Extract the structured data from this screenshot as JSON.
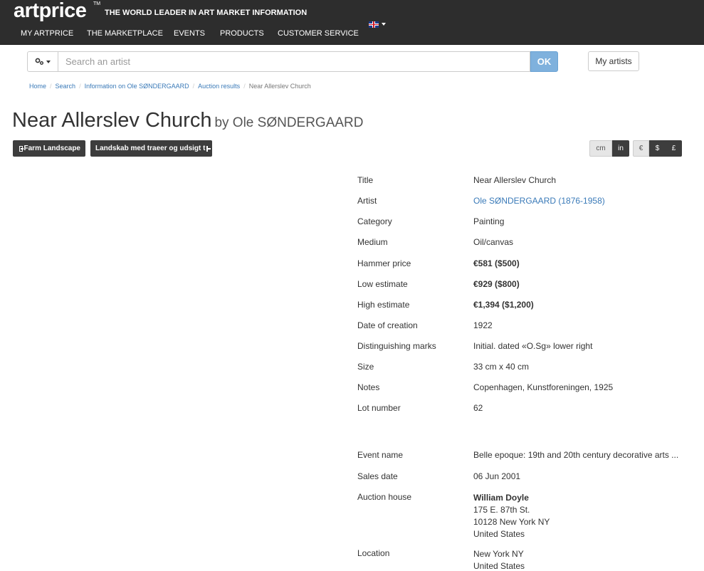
{
  "header": {
    "logo": "artprice",
    "logo_tm": "TM",
    "tagline": "THE WORLD LEADER IN ART MARKET INFORMATION",
    "nav": [
      "MY ARTPRICE",
      "THE MARKETPLACE",
      "EVENTS",
      "PRODUCTS",
      "CUSTOMER SERVICE"
    ],
    "language_icon": "uk-flag-icon"
  },
  "search": {
    "placeholder": "Search an artist",
    "ok_label": "OK",
    "options_icon": "gears-icon",
    "my_artists_label": "My artists"
  },
  "breadcrumb": [
    "Home",
    "Search",
    "Information on Ole SØNDERGAARD",
    "Auction results",
    "Near Allerslev Church"
  ],
  "title": {
    "artwork": "Near Allerslev Church",
    "by": "by Ole SØNDERGAARD"
  },
  "tags": {
    "prev": "Farm Landscape",
    "next": "Landskab med traeer og udsigt t"
  },
  "units": {
    "length": [
      "cm",
      "in"
    ],
    "currency": [
      "€",
      "$",
      "£"
    ]
  },
  "details": [
    {
      "label": "Title",
      "value": "Near Allerslev Church"
    },
    {
      "label": "Artist",
      "value": "Ole SØNDERGAARD (1876-1958)"
    },
    {
      "label": "Category",
      "value": "Painting"
    },
    {
      "label": "Medium",
      "value": "Oil/canvas"
    },
    {
      "label": "Hammer price",
      "value": "€581 ($500)"
    },
    {
      "label": "Low estimate",
      "value": "€929 ($800)"
    },
    {
      "label": "High estimate",
      "value": "€1,394 ($1,200)"
    },
    {
      "label": "Date of creation",
      "value": "1922"
    },
    {
      "label": "Distinguishing marks",
      "value": "Initial. dated «O.Sg» lower right"
    },
    {
      "label": "Size",
      "value": "33 cm x 40 cm"
    },
    {
      "label": "Notes",
      "value": "Copenhagen, Kunstforeningen, 1925"
    },
    {
      "label": "Lot number",
      "value": "62"
    },
    {
      "label": "Event name",
      "value": "Belle epoque: 19th and 20th century decorative arts ..."
    },
    {
      "label": "Sales date",
      "value": "06 Jun 2001"
    },
    {
      "label": "Auction house",
      "value": "William Doyle",
      "lines": [
        "175 E. 87th St.",
        "10128 New York NY",
        "United States"
      ]
    },
    {
      "label": "Location",
      "value": "New York NY",
      "lines": [
        "United States"
      ]
    }
  ],
  "colors": {
    "header_bg": "#2d2d2d",
    "link": "#3a7ab8",
    "ok_button": "#7fb1dd",
    "dark_button": "#3d3d3d"
  }
}
